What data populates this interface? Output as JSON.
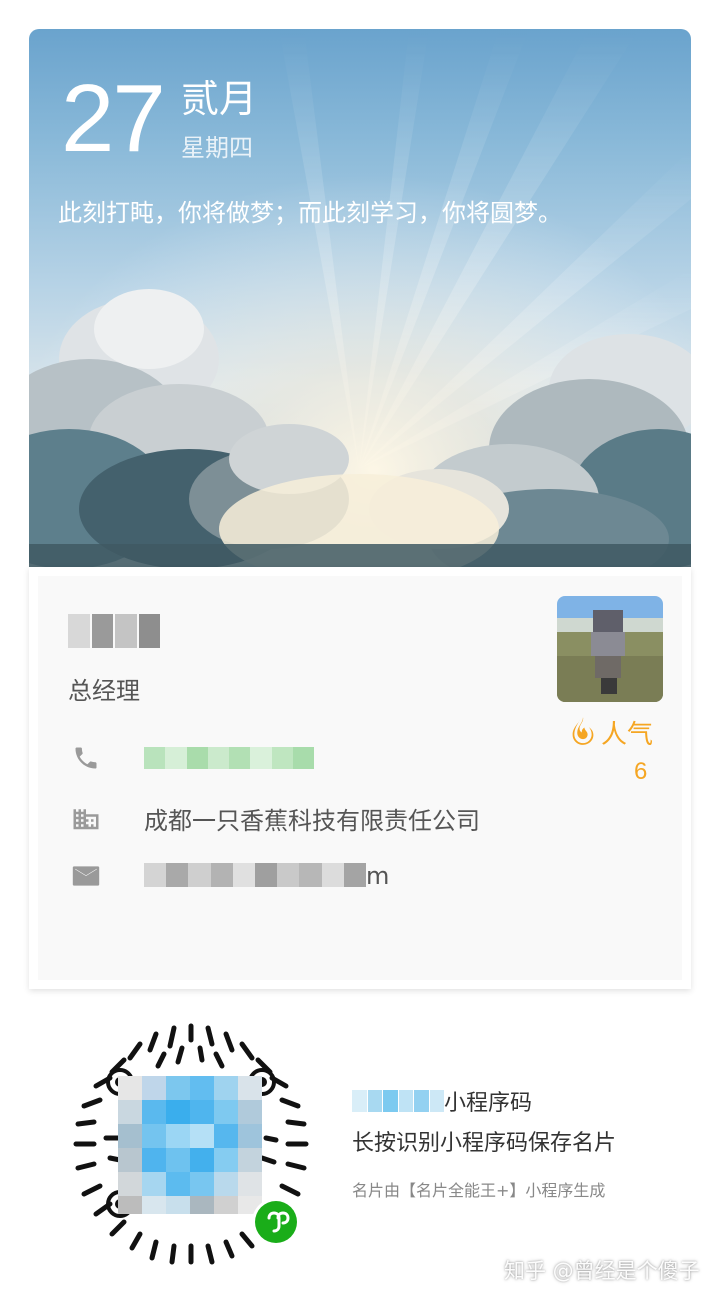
{
  "hero": {
    "day": "27",
    "month": "贰月",
    "weekday": "星期四",
    "quote": "此刻打盹，你将做梦；而此刻学习，你将圆梦。"
  },
  "card": {
    "job_title": "总经理",
    "company": "成都一只香蕉科技有限责任公司",
    "email_tail": "m",
    "popularity_label": "人气",
    "popularity_count": "6",
    "icons": [
      "phone-icon",
      "building-icon",
      "mail-icon",
      "fire-icon"
    ]
  },
  "qr": {
    "title_suffix": "小程序码",
    "hint": "长按识别小程序码保存名片",
    "footnote": "名片由【名片全能王+】小程序生成"
  },
  "watermark": "知乎 @曾经是个傻子",
  "colors": {
    "accent": "#f5a623",
    "text": "#555555",
    "badge": "#1aad19"
  }
}
